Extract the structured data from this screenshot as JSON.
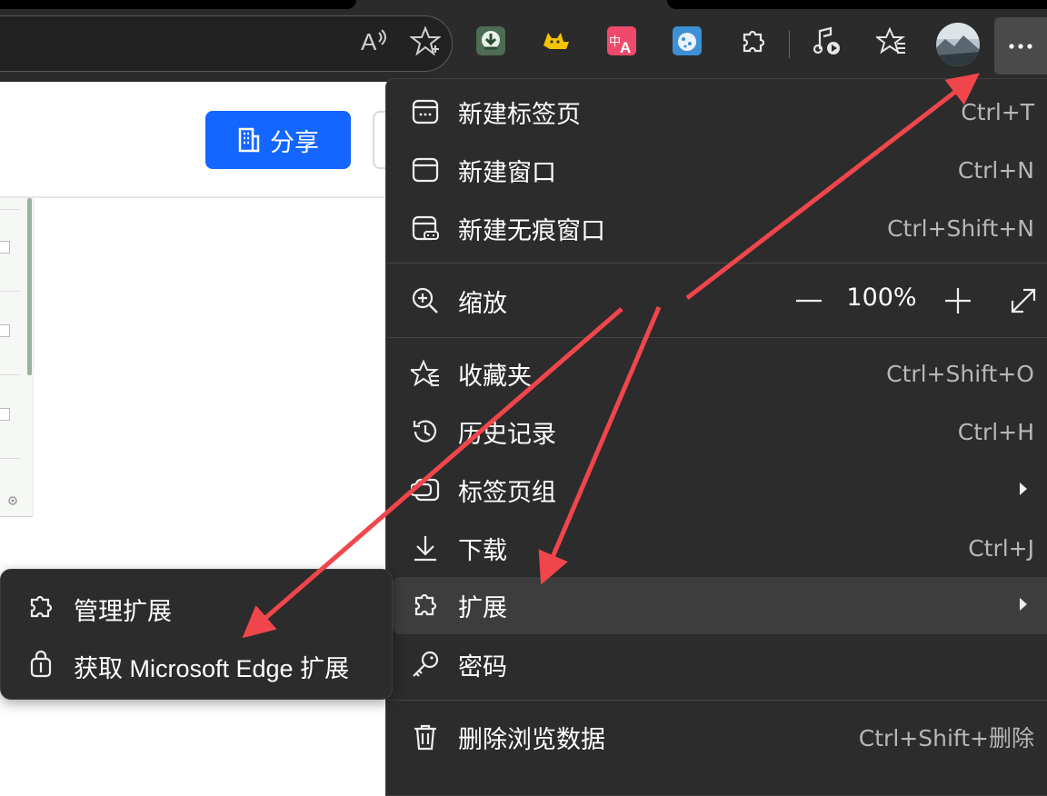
{
  "colors": {
    "menu_bg": "#2c2c2c",
    "highlight": "#3d3d3d",
    "share_button": "#1366ff",
    "annotation_arrow": "#f0464b"
  },
  "toolbar": {
    "icons": [
      "read-aloud-icon",
      "favorite-star-icon",
      "download-extension-icon",
      "cat-extension-icon",
      "translate-extension-icon",
      "cookie-extension-icon",
      "extensions-icon",
      "media-control-icon",
      "favorites-icon",
      "profile-avatar",
      "more-menu-icon"
    ]
  },
  "page": {
    "share_label": "分享"
  },
  "menu": {
    "items": [
      {
        "label": "新建标签页",
        "shortcut": "Ctrl+T",
        "icon": "new-tab-icon"
      },
      {
        "label": "新建窗口",
        "shortcut": "Ctrl+N",
        "icon": "new-window-icon"
      },
      {
        "label": "新建无痕窗口",
        "shortcut": "Ctrl+Shift+N",
        "icon": "inprivate-window-icon"
      },
      {
        "label": "缩放",
        "icon": "zoom-icon",
        "zoom_value": "100%"
      },
      {
        "label": "收藏夹",
        "shortcut": "Ctrl+Shift+O",
        "icon": "favorites-icon"
      },
      {
        "label": "历史记录",
        "shortcut": "Ctrl+H",
        "icon": "history-icon"
      },
      {
        "label": "标签页组",
        "icon": "tab-groups-icon",
        "has_submenu": true
      },
      {
        "label": "下载",
        "shortcut": "Ctrl+J",
        "icon": "download-icon"
      },
      {
        "label": "扩展",
        "icon": "extensions-icon",
        "has_submenu": true,
        "highlighted": true
      },
      {
        "label": "密码",
        "icon": "key-icon"
      },
      {
        "label": "删除浏览数据",
        "shortcut": "Ctrl+Shift+删除",
        "icon": "trash-icon"
      }
    ]
  },
  "submenu": {
    "items": [
      {
        "label": "管理扩展",
        "icon": "puzzle-icon"
      },
      {
        "label": "获取 Microsoft Edge 扩展",
        "icon": "shopping-bag-icon"
      }
    ]
  }
}
